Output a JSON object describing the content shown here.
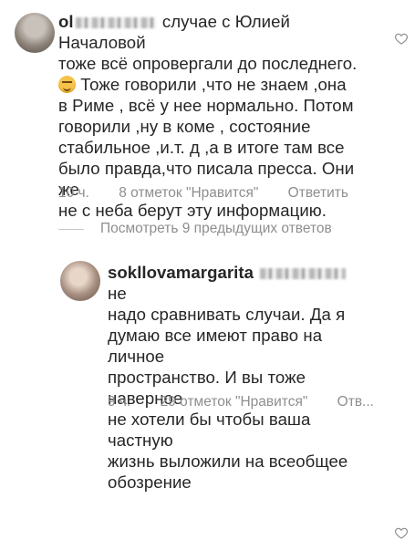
{
  "comments": [
    {
      "username": "ol",
      "text_lines": [
        "случае с Юлией Началовой",
        "тоже всё опровергали до последнего.",
        "Тоже говорили ,что не знаем ,она",
        "в Риме , всё у нее нормально.  Потом",
        "говорили ,ну в коме , состояние",
        "стабильное ,и.т. д ,а в итоге там все",
        "было правда,что писала пресса. Они же",
        "не с неба берут эту информацию."
      ],
      "time": "10 ч.",
      "likes": "8 отметок \"Нравится\"",
      "reply_label": "Ответить"
    },
    {
      "username": "sokllovamargarita",
      "text_lines": [
        "не",
        "надо сравнивать случаи. Да я",
        "думаю все имеют право на личное",
        "пространство. И вы тоже наверное",
        "не хотели бы чтобы ваша частную",
        "жизнь выложили на всеобщее",
        "обозрение"
      ],
      "time": "9 ч.",
      "likes": "29 отметок \"Нравится\"",
      "reply_label": "Отв..."
    }
  ],
  "view_replies": "Посмотреть 9 предыдущих ответов",
  "icons": {
    "avatar_1": "avatar",
    "avatar_2": "avatar",
    "like": "heart-outline-icon",
    "emoji": "smirking-face-emoji"
  },
  "colors": {
    "text": "#262626",
    "meta": "#8e8e8e"
  }
}
